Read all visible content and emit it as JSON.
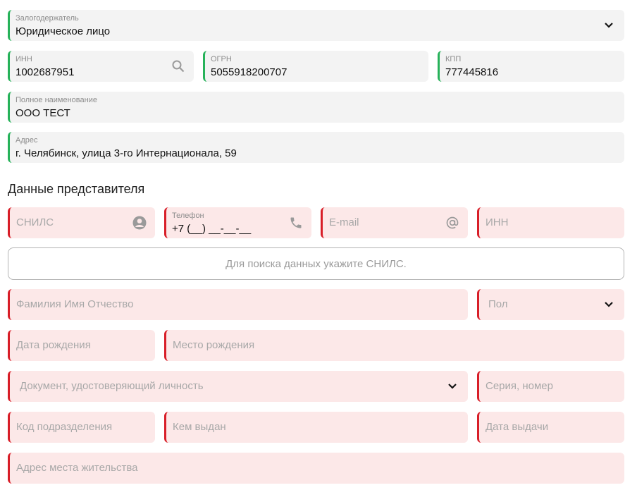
{
  "pledgor": {
    "label": "Залогодержатель",
    "value": "Юридическое лицо"
  },
  "inn": {
    "label": "ИНН",
    "value": "1002687951"
  },
  "ogrn": {
    "label": "ОГРН",
    "value": "5055918200707"
  },
  "kpp": {
    "label": "КПП",
    "value": "777445816"
  },
  "full_name": {
    "label": "Полное наименование",
    "value": "ООО ТЕСТ"
  },
  "address": {
    "label": "Адрес",
    "value": "г. Челябинск, улица 3-го Интернационала, 59"
  },
  "representative": {
    "title": "Данные представителя",
    "snils": {
      "placeholder": "СНИЛС"
    },
    "phone": {
      "label": "Телефон",
      "value": "+7 (__) __-__-__"
    },
    "email": {
      "placeholder": "E-mail"
    },
    "inn": {
      "placeholder": "ИНН"
    },
    "search_hint": "Для поиска данных укажите СНИЛС.",
    "fio": {
      "placeholder": "Фамилия Имя Отчество"
    },
    "gender": {
      "placeholder": "Пол"
    },
    "birth_date": {
      "placeholder": "Дата рождения"
    },
    "birth_place": {
      "placeholder": "Место рождения"
    },
    "id_document": {
      "placeholder": "Документ, удостоверяющий личность"
    },
    "series_number": {
      "placeholder": "Серия, номер"
    },
    "dept_code": {
      "placeholder": "Код подразделения"
    },
    "issued_by": {
      "placeholder": "Кем выдан"
    },
    "issue_date": {
      "placeholder": "Дата выдачи"
    },
    "residence_address": {
      "placeholder": "Адрес места жительства"
    }
  },
  "colors": {
    "valid_border": "#27b25a",
    "error_border": "#d81e28",
    "error_bg": "#fce8e8",
    "field_bg": "#f3f3f3"
  }
}
